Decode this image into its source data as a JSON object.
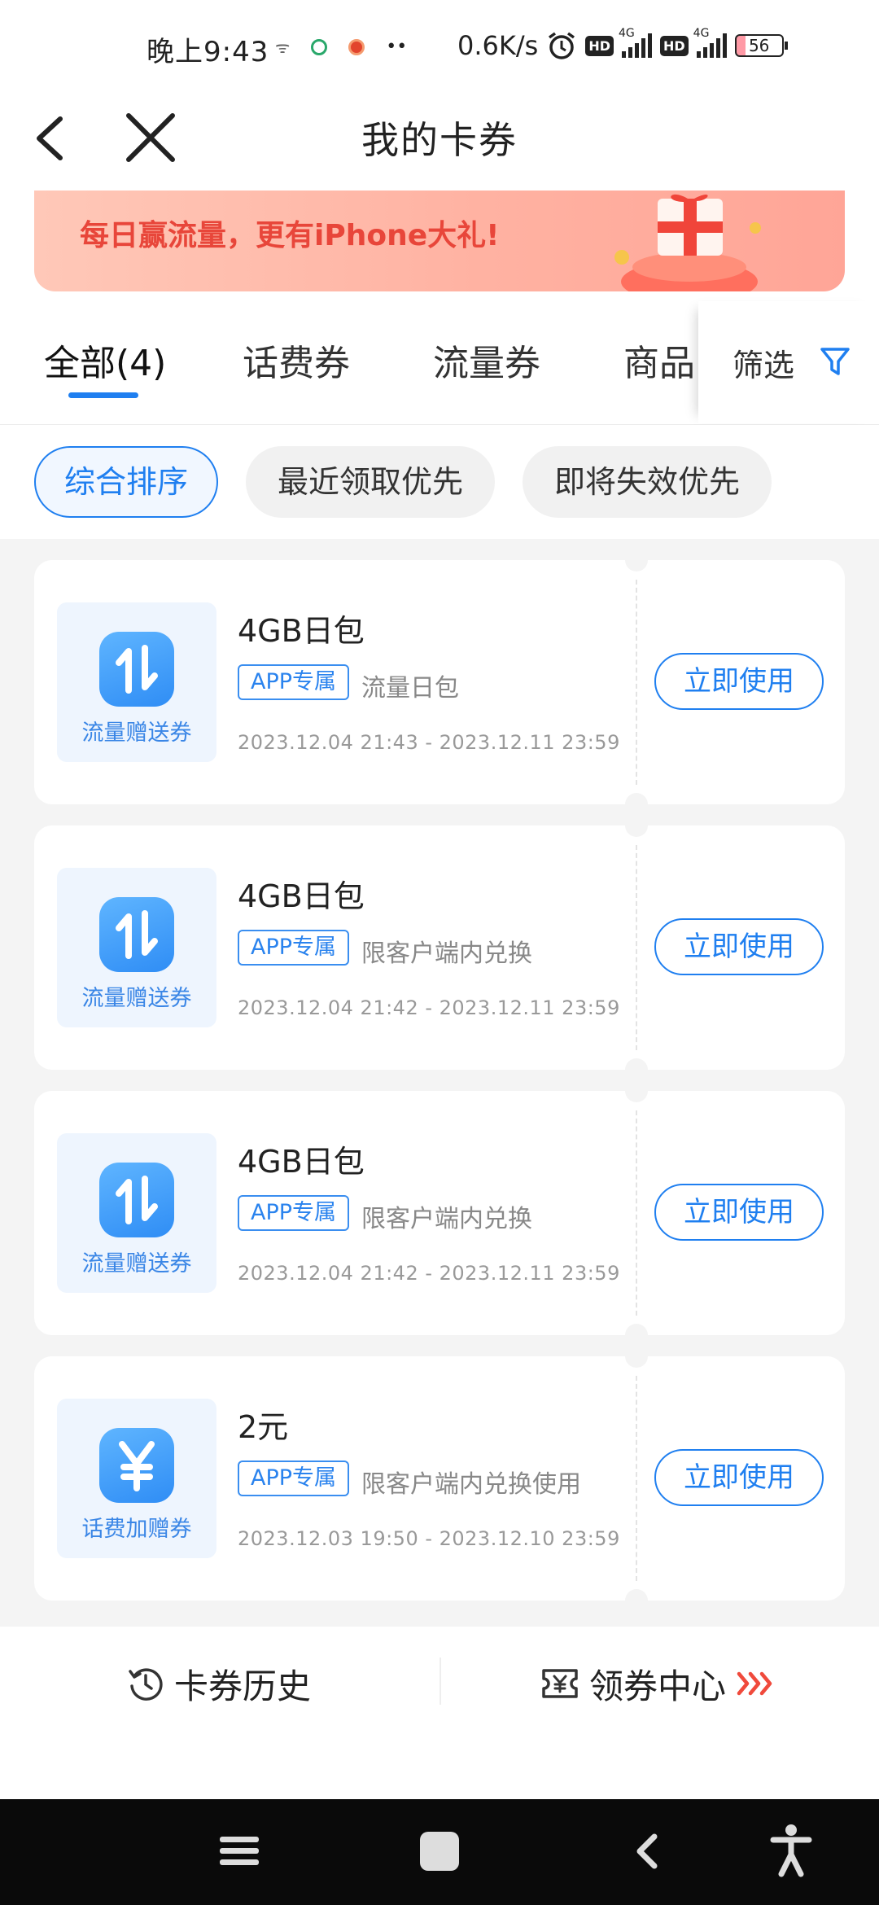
{
  "status_bar": {
    "time": "晚上9:43",
    "speed": "0.6K/s",
    "hd": "HD",
    "network": "4G",
    "battery": "56"
  },
  "nav": {
    "title": "我的卡券"
  },
  "banner": {
    "text": "每日赢流量，更有iPhone大礼!"
  },
  "tabs": {
    "items": [
      "全部(4)",
      "话费券",
      "流量券",
      "商品"
    ],
    "filter_label": "筛选"
  },
  "sort": {
    "options": [
      "综合排序",
      "最近领取优先",
      "即将失效优先"
    ]
  },
  "coupons": [
    {
      "icon": "data-transfer-icon",
      "type_label": "流量赠送券",
      "title": "4GB日包",
      "tag": "APP专属",
      "desc": "流量日包",
      "date": "2023.12.04 21:43 - 2023.12.11 23:59",
      "action": "立即使用"
    },
    {
      "icon": "data-transfer-icon",
      "type_label": "流量赠送券",
      "title": "4GB日包",
      "tag": "APP专属",
      "desc": "限客户端内兑换",
      "date": "2023.12.04 21:42 - 2023.12.11 23:59",
      "action": "立即使用"
    },
    {
      "icon": "data-transfer-icon",
      "type_label": "流量赠送券",
      "title": "4GB日包",
      "tag": "APP专属",
      "desc": "限客户端内兑换",
      "date": "2023.12.04 21:42 - 2023.12.11 23:59",
      "action": "立即使用"
    },
    {
      "icon": "yuan-icon",
      "type_label": "话费加赠券",
      "title": "2元",
      "tag": "APP专属",
      "desc": "限客户端内兑换使用",
      "date": "2023.12.03 19:50 - 2023.12.10 23:59",
      "action": "立即使用"
    }
  ],
  "bottom": {
    "history": "卡券历史",
    "center": "领券中心"
  },
  "colors": {
    "accent": "#1f7ff0",
    "banner_text": "#e8463a"
  }
}
